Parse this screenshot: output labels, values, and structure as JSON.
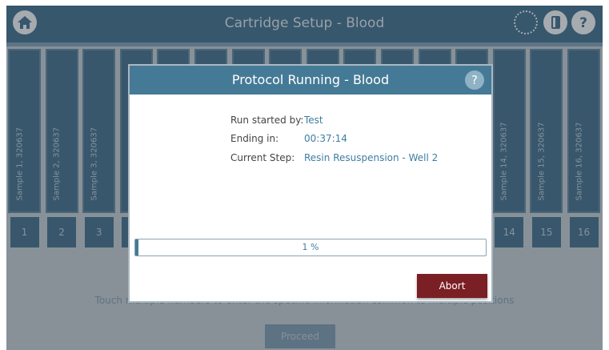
{
  "topbar": {
    "title": "Cartridge Setup - Blood",
    "icons": [
      "home-icon",
      "loading-spinner-icon",
      "document-icon",
      "help-icon"
    ]
  },
  "samples": [
    {
      "label": "Sample 1, 320637",
      "number": "1"
    },
    {
      "label": "Sample 2, 320637",
      "number": "2"
    },
    {
      "label": "Sample 3, 320637",
      "number": "3"
    },
    {
      "label": "",
      "number": ""
    },
    {
      "label": "",
      "number": ""
    },
    {
      "label": "",
      "number": ""
    },
    {
      "label": "",
      "number": ""
    },
    {
      "label": "",
      "number": ""
    },
    {
      "label": "",
      "number": ""
    },
    {
      "label": "",
      "number": ""
    },
    {
      "label": "",
      "number": ""
    },
    {
      "label": "",
      "number": ""
    },
    {
      "label": "",
      "number": ""
    },
    {
      "label": "Sample 14, 320637",
      "number": "14"
    },
    {
      "label": "Sample 15, 320637",
      "number": "15"
    },
    {
      "label": "Sample 16, 320637",
      "number": "16"
    }
  ],
  "instruction": "Touch multiple numbers to enter the specific information common to multiple positions",
  "proceed_label": "Proceed",
  "modal": {
    "title": "Protocol Running - Blood",
    "help": "?",
    "run_started_label": "Run started by:",
    "run_started_value": "Test",
    "ending_label": "Ending in:",
    "ending_value": "00:37:14",
    "step_label": "Current Step:",
    "step_value": "Resin Resuspension -  Well 2",
    "progress_text": "1 %",
    "progress_fraction": 0.01,
    "abort_label": "Abort"
  },
  "colors": {
    "accent": "#457a97",
    "abort": "#7a1f24",
    "link_text": "#3f7ea2"
  }
}
